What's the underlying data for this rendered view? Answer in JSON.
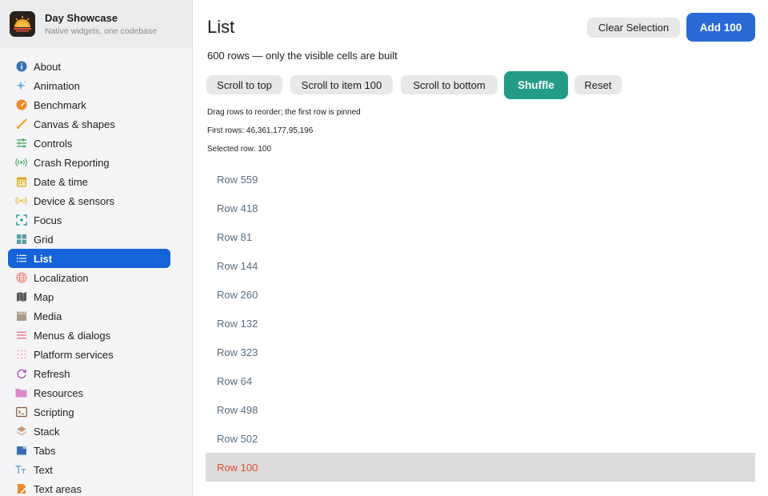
{
  "app": {
    "title": "Day Showcase",
    "subtitle": "Native widgets, one codebase"
  },
  "sidebar": {
    "items": [
      {
        "label": "About",
        "icon": "info-icon",
        "color": "#3a6fb5"
      },
      {
        "label": "Animation",
        "icon": "sparkle-icon",
        "color": "#6fb1e8"
      },
      {
        "label": "Benchmark",
        "icon": "gauge-icon",
        "color": "#f08a24"
      },
      {
        "label": "Canvas & shapes",
        "icon": "brush-icon",
        "color": "#f0a030"
      },
      {
        "label": "Controls",
        "icon": "sliders-icon",
        "color": "#3aa55c"
      },
      {
        "label": "Crash Reporting",
        "icon": "broadcast-icon",
        "color": "#3aa55c"
      },
      {
        "label": "Date & time",
        "icon": "calendar-icon",
        "color": "#d9a21b"
      },
      {
        "label": "Device & sensors",
        "icon": "sensor-icon",
        "color": "#e8b93a"
      },
      {
        "label": "Focus",
        "icon": "focus-icon",
        "color": "#2f9e9e"
      },
      {
        "label": "Grid",
        "icon": "grid-icon",
        "color": "#5aa0a0"
      },
      {
        "label": "List",
        "icon": "list-icon",
        "color": "#ffffff",
        "active": true
      },
      {
        "label": "Localization",
        "icon": "globe-icon",
        "color": "#f08a7a"
      },
      {
        "label": "Map",
        "icon": "map-icon",
        "color": "#555555"
      },
      {
        "label": "Media",
        "icon": "clapper-icon",
        "color": "#a89a86"
      },
      {
        "label": "Menus & dialogs",
        "icon": "menu-icon",
        "color": "#e8788a"
      },
      {
        "label": "Platform services",
        "icon": "dots-icon",
        "color": "#f0a0b0"
      },
      {
        "label": "Refresh",
        "icon": "refresh-icon",
        "color": "#a04ab0"
      },
      {
        "label": "Resources",
        "icon": "folder-icon",
        "color": "#d98ac8"
      },
      {
        "label": "Scripting",
        "icon": "terminal-icon",
        "color": "#8a5a3a"
      },
      {
        "label": "Stack",
        "icon": "stack-icon",
        "color": "#c89a7a"
      },
      {
        "label": "Tabs",
        "icon": "tabs-icon",
        "color": "#3a6fb5"
      },
      {
        "label": "Text",
        "icon": "text-icon",
        "color": "#6aa0d0"
      },
      {
        "label": "Text areas",
        "icon": "text-area-icon",
        "color": "#f08a24"
      }
    ]
  },
  "main": {
    "title": "List",
    "clear_selection": "Clear Selection",
    "add_100": "Add 100",
    "row_count": "600 rows — only the visible cells are built",
    "scroll_top": "Scroll to top",
    "scroll_item": "Scroll to item 100",
    "scroll_bottom": "Scroll to bottom",
    "shuffle": "Shuffle",
    "reset": "Reset",
    "hint": "Drag rows to reorder; the first row is pinned",
    "first_rows": "First rows: 46,361,177,95,196",
    "selected_row": "Selected row: 100",
    "rows": [
      {
        "label": "Row 559"
      },
      {
        "label": "Row 418"
      },
      {
        "label": "Row 81"
      },
      {
        "label": "Row 144"
      },
      {
        "label": "Row 260"
      },
      {
        "label": "Row 132"
      },
      {
        "label": "Row 323"
      },
      {
        "label": "Row 64"
      },
      {
        "label": "Row 498"
      },
      {
        "label": "Row 502"
      },
      {
        "label": "Row 100",
        "selected": true
      }
    ]
  }
}
